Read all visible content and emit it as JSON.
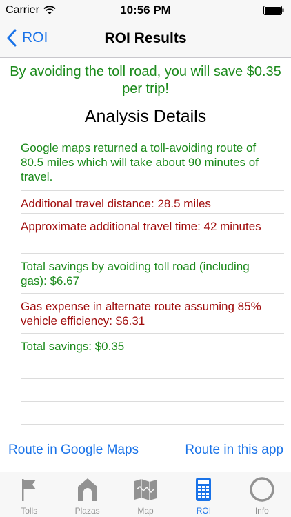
{
  "status_bar": {
    "carrier": "Carrier",
    "time": "10:56 PM"
  },
  "nav": {
    "back_label": "ROI",
    "title": "ROI Results"
  },
  "headline": "By avoiding the toll road, you will save $0.35 per trip!",
  "section_title": "Analysis Details",
  "details": [
    {
      "text": "Google maps returned a toll-avoiding route of 80.5 miles which will take about 90 minutes of travel.",
      "color": "green"
    },
    {
      "text": "Additional travel distance: 28.5 miles",
      "color": "red"
    },
    {
      "text": "Approximate additional travel time: 42 minutes",
      "color": "red"
    },
    {
      "text": "Total savings by avoiding toll road (including gas): $6.67",
      "color": "green"
    },
    {
      "text": "Gas expense in alternate route assuming 85% vehicle efficiency: $6.31",
      "color": "red"
    },
    {
      "text": "Total savings: $0.35",
      "color": "green"
    }
  ],
  "links": {
    "google_maps": "Route in Google Maps",
    "this_app": "Route in this app"
  },
  "tabs": [
    {
      "label": "Tolls",
      "icon": "flag-icon",
      "active": false
    },
    {
      "label": "Plazas",
      "icon": "house-icon",
      "active": false
    },
    {
      "label": "Map",
      "icon": "map-icon",
      "active": false
    },
    {
      "label": "ROI",
      "icon": "calculator-icon",
      "active": true
    },
    {
      "label": "Info",
      "icon": "circle-icon",
      "active": false
    }
  ],
  "colors": {
    "accent": "#1a73e8",
    "positive": "#1b8a1b",
    "negative": "#a00d0d",
    "inactive_tab": "#929292"
  }
}
